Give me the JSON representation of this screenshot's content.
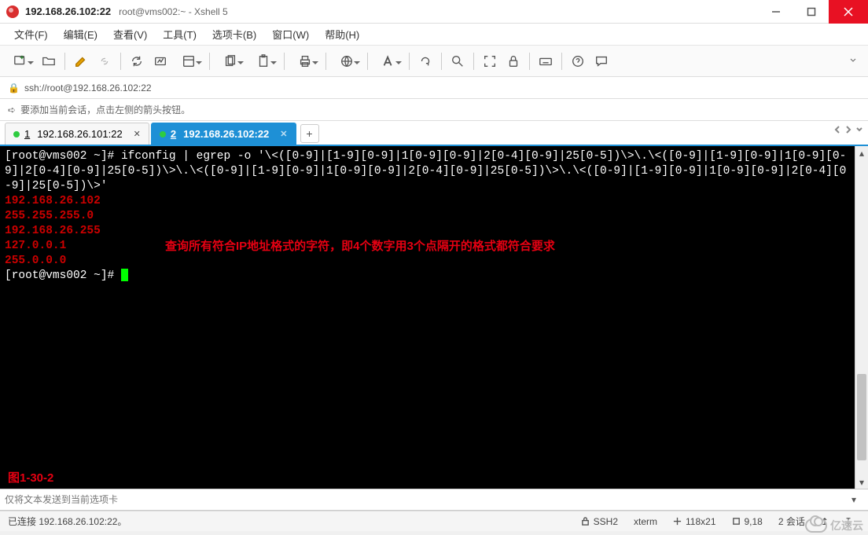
{
  "window": {
    "title_ip": "192.168.26.102:22",
    "title_suffix": "root@vms002:~ - Xshell 5"
  },
  "menu": {
    "file": "文件(F)",
    "edit": "编辑(E)",
    "view": "查看(V)",
    "tools": "工具(T)",
    "tabs": "选项卡(B)",
    "window": "窗口(W)",
    "help": "帮助(H)"
  },
  "address": {
    "url": "ssh://root@192.168.26.102:22"
  },
  "hint": {
    "text": "要添加当前会话，点击左侧的箭头按钮。"
  },
  "tabs": [
    {
      "num": "1",
      "label": "192.168.26.101:22",
      "active": false
    },
    {
      "num": "2",
      "label": "192.168.26.102:22",
      "active": true
    }
  ],
  "terminal": {
    "prompt1": "[root@vms002 ~]# ",
    "cmd": "ifconfig | egrep -o '\\<([0-9]|[1-9][0-9]|1[0-9][0-9]|2[0-4][0-9]|25[0-5])\\>\\.\\<([0-9]|[1-9][0-9]|1[0-9][0-9]|2[0-4][0-9]|25[0-5])\\>\\.\\<([0-9]|[1-9][0-9]|1[0-9][0-9]|2[0-4][0-9]|25[0-5])\\>\\.\\<([0-9]|[1-9][0-9]|1[0-9][0-9]|2[0-4][0-9]|25[0-5])\\>'",
    "out1": "192.168.26.102",
    "out2": "255.255.255.0",
    "out3": "192.168.26.255",
    "out4": "127.0.0.1",
    "out5": "255.0.0.0",
    "prompt2": "[root@vms002 ~]# ",
    "annotation": "查询所有符合IP地址格式的字符，即4个数字用3个点隔开的格式都符合要求",
    "figure": "图1-30-2"
  },
  "sendbar": {
    "placeholder": "仅将文本发送到当前选项卡"
  },
  "status": {
    "conn": "已连接 192.168.26.102:22。",
    "proto": "SSH2",
    "term": "xterm",
    "size": "118x21",
    "pos": "9,18",
    "sessions": "2 会话"
  },
  "watermark": "亿速云"
}
